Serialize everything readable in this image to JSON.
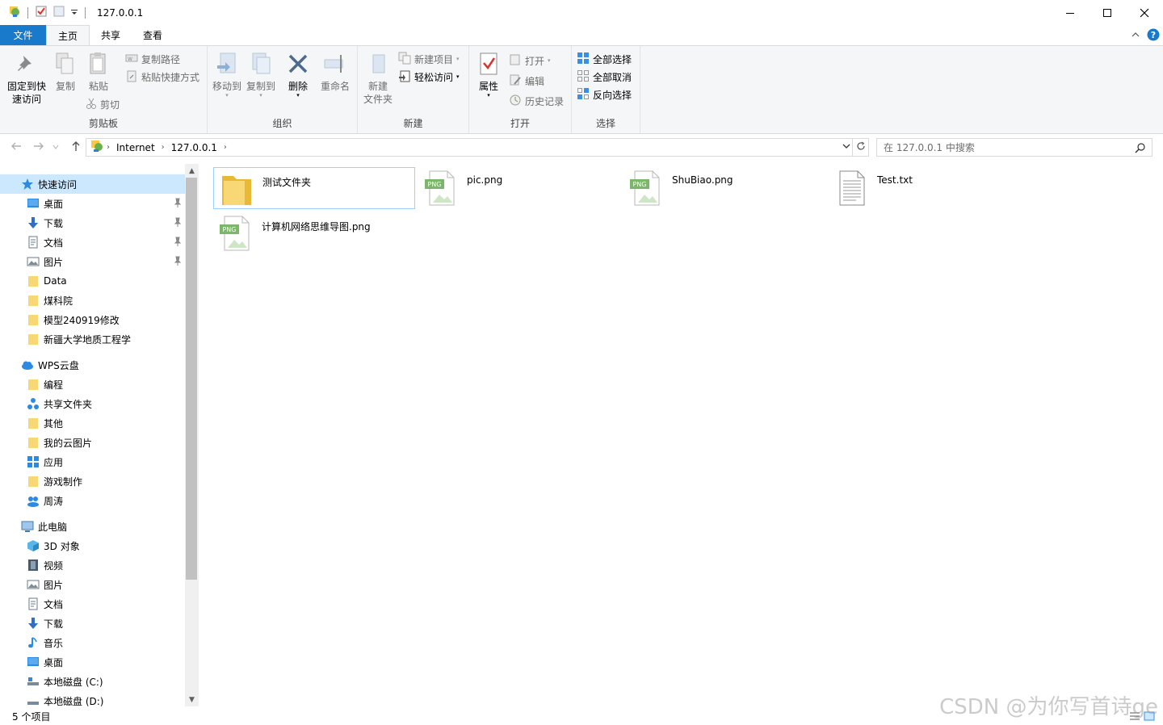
{
  "window": {
    "title": "127.0.0.1"
  },
  "tabs": [
    {
      "label": "文件"
    },
    {
      "label": "主页"
    },
    {
      "label": "共享"
    },
    {
      "label": "查看"
    }
  ],
  "ribbon": {
    "clipboard": {
      "label": "剪贴板",
      "pin_line1": "固定到快",
      "pin_line2": "速访问",
      "copy": "复制",
      "paste": "粘贴",
      "copy_path": "复制路径",
      "paste_shortcut": "粘贴快捷方式",
      "cut": "剪切"
    },
    "organize": {
      "label": "组织",
      "move_to": "移动到",
      "copy_to": "复制到",
      "delete": "删除",
      "rename": "重命名"
    },
    "new": {
      "label": "新建",
      "new_folder_line1": "新建",
      "new_folder_line2": "文件夹",
      "new_item": "新建项目",
      "easy_access": "轻松访问"
    },
    "open": {
      "label": "打开",
      "properties": "属性",
      "open": "打开",
      "edit": "编辑",
      "history": "历史记录"
    },
    "select": {
      "label": "选择",
      "select_all": "全部选择",
      "select_none": "全部取消",
      "invert": "反向选择"
    }
  },
  "address": {
    "crumbs": [
      "Internet",
      "127.0.0.1"
    ],
    "search_placeholder": "在 127.0.0.1 中搜索"
  },
  "sidebar": {
    "quick_access": {
      "label": "快速访问",
      "items": [
        "桌面",
        "下载",
        "文档",
        "图片",
        "Data",
        "煤科院",
        "模型240919修改",
        "新疆大学地质工程学"
      ]
    },
    "wps": {
      "label": "WPS云盘",
      "items": [
        "编程",
        "共享文件夹",
        "其他",
        "我的云图片",
        "应用",
        "游戏制作",
        "周涛"
      ]
    },
    "this_pc": {
      "label": "此电脑",
      "items": [
        "3D 对象",
        "视频",
        "图片",
        "文档",
        "下载",
        "音乐",
        "桌面",
        "本地磁盘 (C:)",
        "本地磁盘 (D:)"
      ]
    }
  },
  "files": [
    {
      "name": "测试文件夹",
      "type": "folder"
    },
    {
      "name": "pic.png",
      "type": "png"
    },
    {
      "name": "ShuBiao.png",
      "type": "png"
    },
    {
      "name": "Test.txt",
      "type": "txt"
    },
    {
      "name": "计算机网络思维导图.png",
      "type": "png"
    }
  ],
  "status": {
    "item_count": "5 个项目"
  },
  "watermark": "CSDN @为你写首诗ge",
  "colors": {
    "file_tab": "#1979ca",
    "selection": "#cce8ff",
    "folder": "#f8d775",
    "accent_blue": "#0078d7"
  }
}
